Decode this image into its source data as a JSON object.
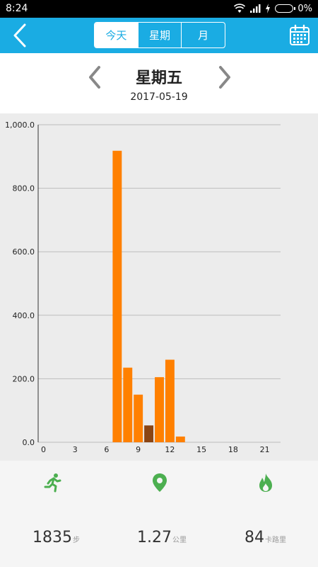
{
  "status_bar": {
    "time": "8:24",
    "battery": "0%"
  },
  "header": {
    "tabs": [
      {
        "label": "今天",
        "active": true
      },
      {
        "label": "星期",
        "active": false
      },
      {
        "label": "月",
        "active": false
      }
    ],
    "accent_color": "#1aace3"
  },
  "day_nav": {
    "day_name": "星期五",
    "date": "2017-05-19"
  },
  "chart_data": {
    "type": "bar",
    "title": "",
    "xlabel": "",
    "ylabel": "",
    "x_ticks": [
      "0",
      "3",
      "6",
      "9",
      "12",
      "15",
      "18",
      "21"
    ],
    "y_ticks": [
      "0.0",
      "200.0",
      "400.0",
      "600.0",
      "800.0",
      "1,000.0"
    ],
    "ylim": [
      0,
      1000
    ],
    "xlim": [
      0,
      23
    ],
    "grid": true,
    "bars": [
      {
        "hour": 7,
        "value": 918,
        "color": "#ff8000"
      },
      {
        "hour": 8,
        "value": 235,
        "color": "#ff8000"
      },
      {
        "hour": 9,
        "value": 150,
        "color": "#ff8000"
      },
      {
        "hour": 10,
        "value": 53,
        "color": "#8b4513"
      },
      {
        "hour": 11,
        "value": 205,
        "color": "#ff8000"
      },
      {
        "hour": 12,
        "value": 260,
        "color": "#ff8000"
      },
      {
        "hour": 13,
        "value": 18,
        "color": "#ff8000"
      }
    ]
  },
  "stats": {
    "steps": {
      "value": "1835",
      "unit": "步",
      "icon": "running-person-icon"
    },
    "distance": {
      "value": "1.27",
      "unit": "公里",
      "icon": "location-pin-icon"
    },
    "calories": {
      "value": "84",
      "unit": "卡路里",
      "icon": "flame-icon"
    },
    "icon_color": "#4caf50"
  }
}
